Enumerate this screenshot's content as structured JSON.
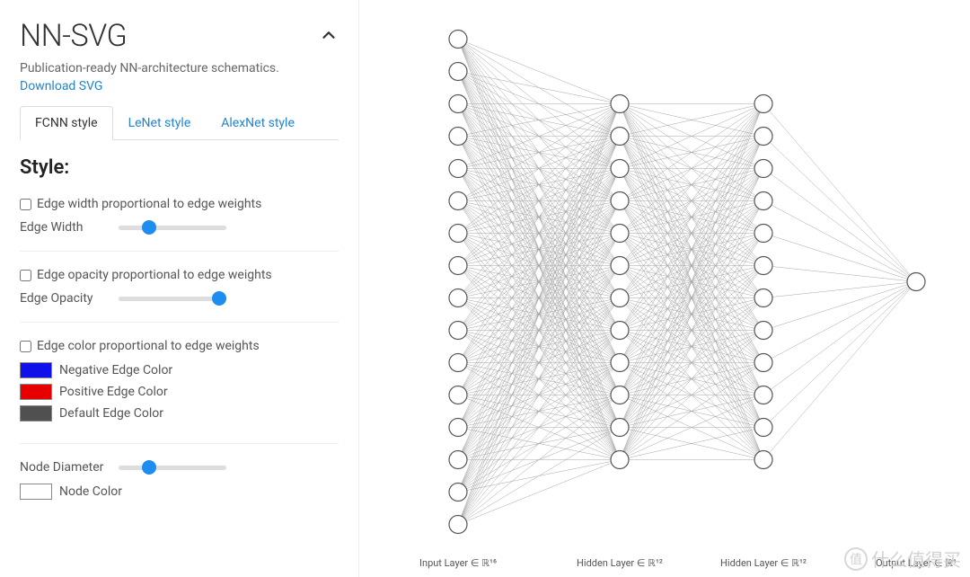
{
  "app": {
    "title": "NN-SVG",
    "subtitle": "Publication-ready NN-architecture schematics.",
    "download": "Download SVG"
  },
  "tabs": [
    {
      "label": "FCNN style",
      "active": true
    },
    {
      "label": "LeNet style",
      "active": false
    },
    {
      "label": "AlexNet style",
      "active": false
    }
  ],
  "style_heading": "Style:",
  "controls": {
    "edge_width_checkbox": "Edge width proportional to edge weights",
    "edge_width_label": "Edge Width",
    "edge_width_value": 25,
    "edge_opacity_checkbox": "Edge opacity proportional to edge weights",
    "edge_opacity_label": "Edge Opacity",
    "edge_opacity_value": 100,
    "edge_color_checkbox": "Edge color proportional to edge weights",
    "neg_color_label": "Negative Edge Color",
    "neg_color": "#1010e8",
    "pos_color_label": "Positive Edge Color",
    "pos_color": "#e80000",
    "def_color_label": "Default Edge Color",
    "def_color": "#505050",
    "node_diam_label": "Node Diameter",
    "node_diam_value": 25,
    "node_color_label": "Node Color",
    "node_color": "#ffffff"
  },
  "network": {
    "layers": [
      16,
      12,
      12,
      1
    ],
    "labels": [
      "Input Layer ∈ ℝ¹⁶",
      "Hidden Layer ∈ ℝ¹²",
      "Hidden Layer ∈ ℝ¹²",
      "Output Layer ∈ ℝ¹"
    ]
  },
  "watermark": "什么值得买"
}
